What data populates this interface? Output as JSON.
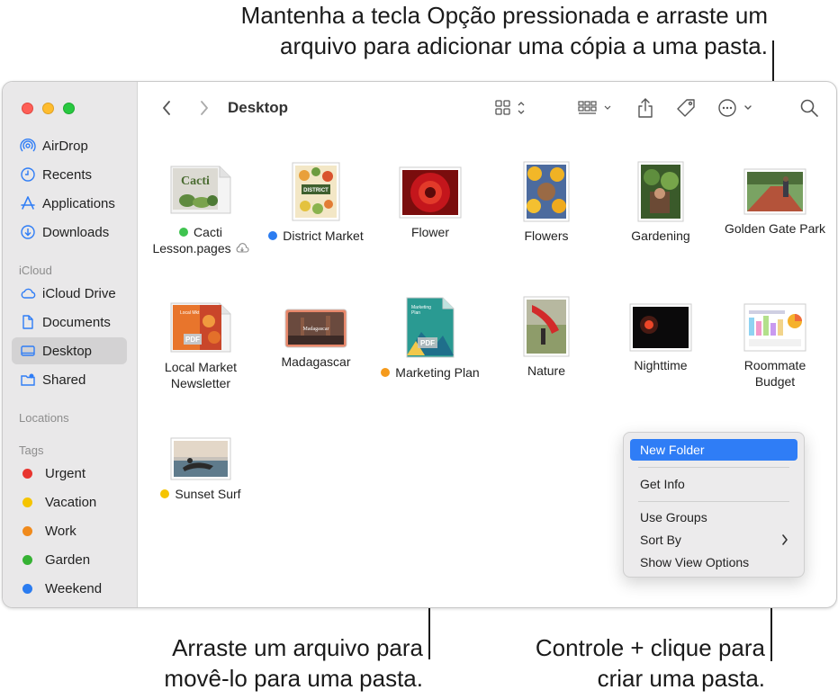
{
  "callouts": {
    "top_line1": "Mantenha a tecla Opção pressionada e arraste um",
    "top_line2": "arquivo para adicionar uma cópia a uma pasta.",
    "bottom_left_line1": "Arraste um arquivo para",
    "bottom_left_line2": "movê-lo para uma pasta.",
    "bottom_right_line1": "Controle + clique para",
    "bottom_right_line2": "criar uma pasta."
  },
  "window": {
    "title": "Desktop"
  },
  "sidebar": {
    "favorites": [
      {
        "label": "AirDrop",
        "icon": "airdrop-icon"
      },
      {
        "label": "Recents",
        "icon": "clock-icon"
      },
      {
        "label": "Applications",
        "icon": "applications-icon"
      },
      {
        "label": "Downloads",
        "icon": "download-icon"
      }
    ],
    "icloud_heading": "iCloud",
    "icloud": [
      {
        "label": "iCloud Drive",
        "icon": "cloud-icon"
      },
      {
        "label": "Documents",
        "icon": "document-icon"
      },
      {
        "label": "Desktop",
        "icon": "desktop-icon",
        "selected": true
      },
      {
        "label": "Shared",
        "icon": "shared-folder-icon"
      }
    ],
    "locations_heading": "Locations",
    "tags_heading": "Tags",
    "tags": [
      {
        "label": "Urgent",
        "color": "#e8352f"
      },
      {
        "label": "Vacation",
        "color": "#f5c400"
      },
      {
        "label": "Work",
        "color": "#f08a1c"
      },
      {
        "label": "Garden",
        "color": "#36b234"
      },
      {
        "label": "Weekend",
        "color": "#2b7cf0"
      }
    ]
  },
  "files": [
    {
      "name": "Cacti Lesson.pages",
      "line1": "Cacti",
      "line2": "Lesson.pages",
      "tag_color": "#3fc34f",
      "cloud": true
    },
    {
      "name": "District Market",
      "tag_color": "#2b7cf0"
    },
    {
      "name": "Flower"
    },
    {
      "name": "Flowers"
    },
    {
      "name": "Gardening"
    },
    {
      "name": "Golden Gate Park"
    },
    {
      "name": "Local Market Newsletter",
      "line1": "Local Market",
      "line2": "Newsletter"
    },
    {
      "name": "Madagascar"
    },
    {
      "name": "Marketing Plan",
      "tag_color": "#f59a1c"
    },
    {
      "name": "Nature"
    },
    {
      "name": "Nighttime"
    },
    {
      "name": "Roommate Budget",
      "line1": "Roommate",
      "line2": "Budget"
    },
    {
      "name": "Sunset Surf",
      "tag_color": "#f5c400"
    }
  ],
  "context_menu": {
    "items": [
      "New Folder",
      "Get Info",
      "Use Groups",
      "Sort By",
      "Show View Options"
    ],
    "highlighted": "New Folder"
  },
  "colors": {
    "accent": "#2f7df6",
    "sidebar_bg": "#e9e8e9",
    "sidebar_icon": "#2f7df6"
  }
}
